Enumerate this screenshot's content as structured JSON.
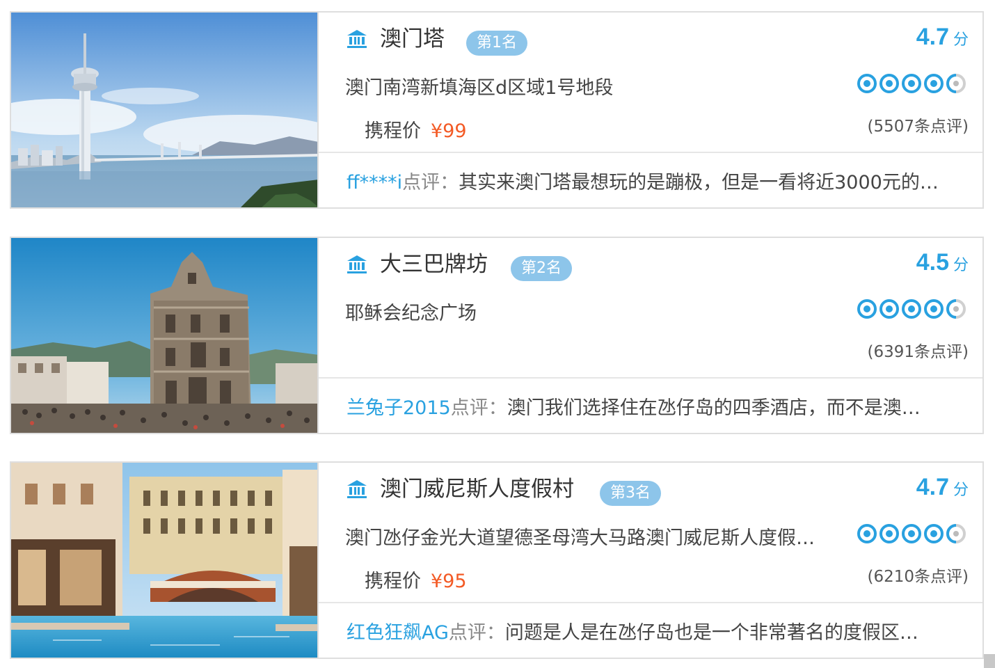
{
  "score_unit": "分",
  "price_label": "携程价",
  "review_label": "点评：",
  "colors": {
    "accent": "#29a1e0",
    "price": "#f35a25",
    "badge": "#8dc5ea",
    "border": "#dedede"
  },
  "icons": {
    "poi": "landmark-icon",
    "rating": "rating-circle-icon"
  },
  "attractions": [
    {
      "name": "澳门塔",
      "rank": "第1名",
      "score": "4.7",
      "rating": 4.7,
      "address": "澳门南湾新填海区d区域1号地段",
      "price": "¥99",
      "reviews": "(5507条点评)",
      "comment_user": "ff****i",
      "comment_text": "其实来澳门塔最想玩的是蹦极，但是一看将近3000元的…"
    },
    {
      "name": "大三巴牌坊",
      "rank": "第2名",
      "score": "4.5",
      "rating": 4.5,
      "address": "耶稣会纪念广场",
      "reviews": "(6391条点评)",
      "comment_user": "兰兔子2015",
      "comment_text": "澳门我们选择住在氹仔岛的四季酒店，而不是澳…"
    },
    {
      "name": "澳门威尼斯人度假村",
      "rank": "第3名",
      "score": "4.7",
      "rating": 4.7,
      "address": "澳门氹仔金光大道望德圣母湾大马路澳门威尼斯人度假…",
      "price": "¥95",
      "reviews": "(6210条点评)",
      "comment_user": "红色狂飙AG",
      "comment_text": "问题是人是在氹仔岛也是一个非常著名的度假区…"
    }
  ]
}
